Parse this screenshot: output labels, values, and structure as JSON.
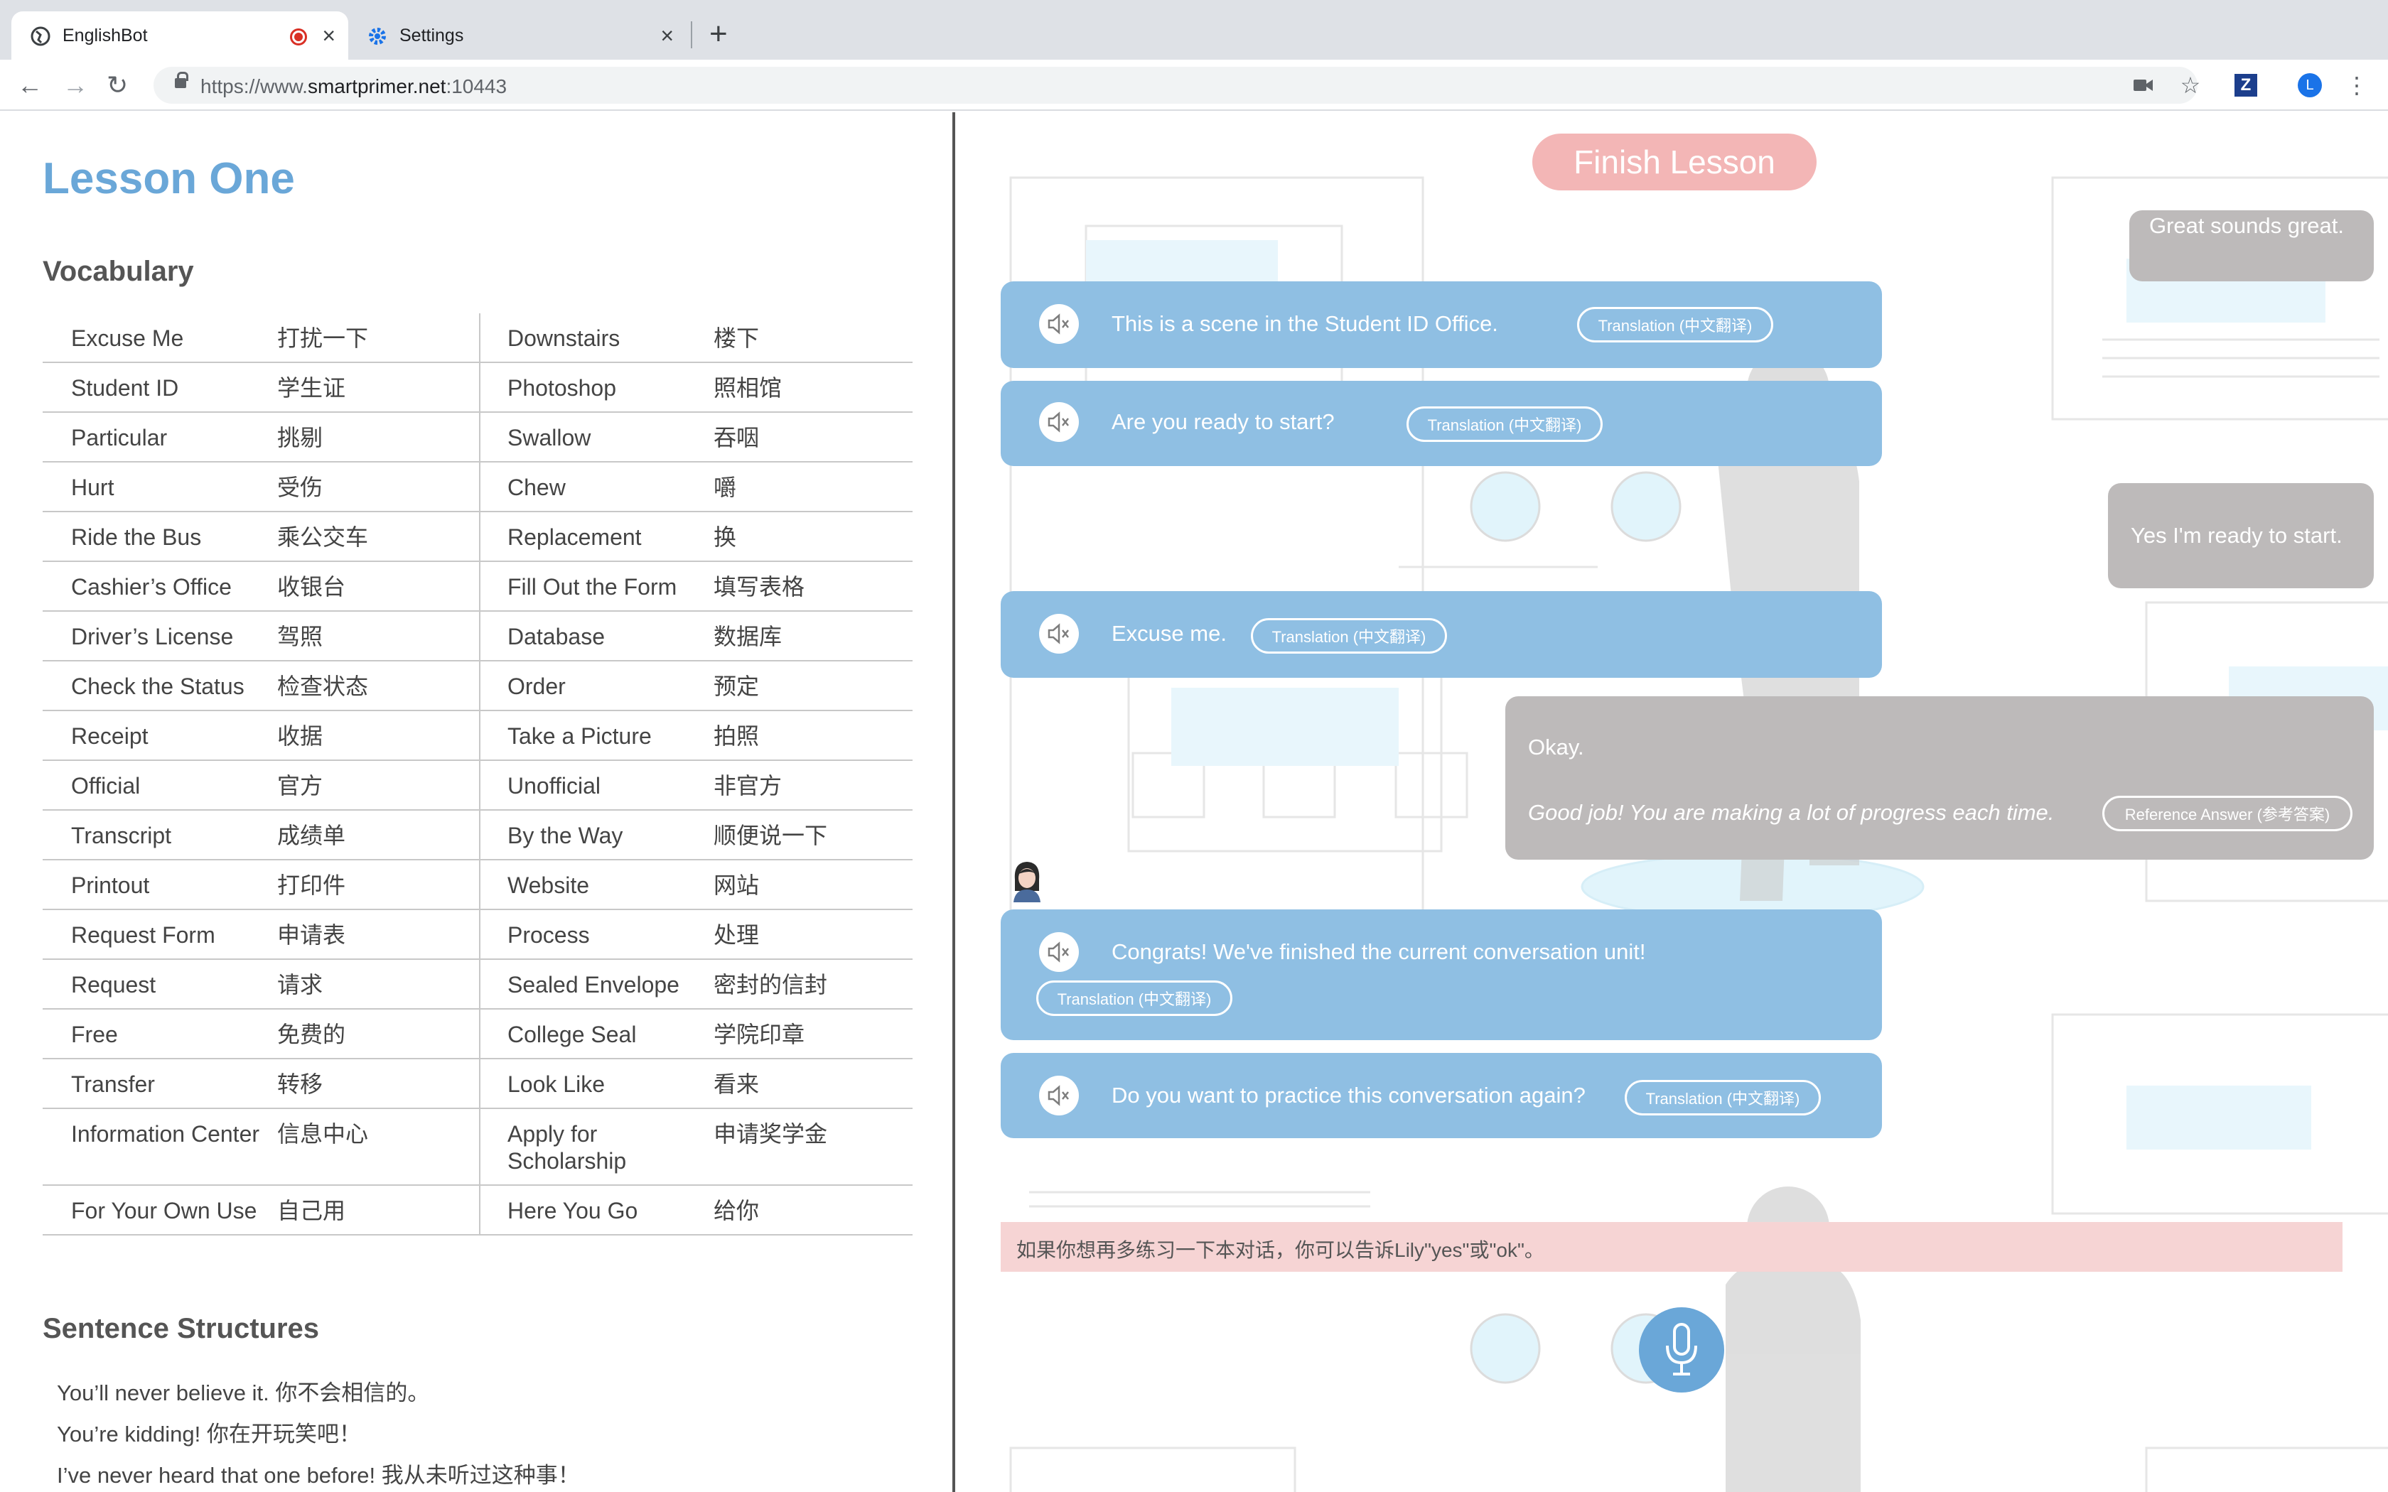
{
  "browser": {
    "tabs": [
      {
        "title": "EnglishBot",
        "active": true
      },
      {
        "title": "Settings",
        "active": false
      }
    ],
    "url": {
      "prefix": "https://www.",
      "host": "smartprimer.net",
      "port": ":10443"
    },
    "profile_letter": "L"
  },
  "lesson": {
    "title": "Lesson One",
    "vocab_heading": "Vocabulary",
    "vocab": [
      [
        "Excuse Me",
        "打扰一下",
        "Downstairs",
        "楼下"
      ],
      [
        "Student ID",
        "学生证",
        "Photoshop",
        "照相馆"
      ],
      [
        "Particular",
        "挑剔",
        "Swallow",
        "吞咽"
      ],
      [
        "Hurt",
        "受伤",
        "Chew",
        "嚼"
      ],
      [
        "Ride the Bus",
        "乘公交车",
        "Replacement",
        "换"
      ],
      [
        "Cashier’s Office",
        "收银台",
        "Fill Out the Form",
        "填写表格"
      ],
      [
        "Driver’s License",
        "驾照",
        "Database",
        "数据库"
      ],
      [
        "Check the Status",
        "检查状态",
        "Order",
        "预定"
      ],
      [
        "Receipt",
        "收据",
        "Take a Picture",
        "拍照"
      ],
      [
        "Official",
        "官方",
        "Unofficial",
        "非官方"
      ],
      [
        "Transcript",
        "成绩单",
        "By the Way",
        "顺便说一下"
      ],
      [
        "Printout",
        "打印件",
        "Website",
        "网站"
      ],
      [
        "Request Form",
        "申请表",
        "Process",
        "处理"
      ],
      [
        "Request",
        "请求",
        "Sealed Envelope",
        "密封的信封"
      ],
      [
        "Free",
        "免费的",
        "College Seal",
        "学院印章"
      ],
      [
        "Transfer",
        "转移",
        "Look Like",
        "看来"
      ],
      [
        "Information Center",
        "信息中心",
        "Apply for Scholarship",
        "申请奖学金"
      ],
      [
        "For Your Own Use",
        "自己用",
        "Here You Go",
        "给你"
      ]
    ],
    "sentence_heading": "Sentence Structures",
    "sentences": [
      "You’ll never believe it. 你不会相信的。",
      "You’re kidding! 你在开玩笑吧！",
      "I’ve never heard that one before! 我从未听过这种事！"
    ]
  },
  "chat": {
    "finish_label": "Finish Lesson",
    "translation_label": "Translation (中文翻译)",
    "reference_label": "Reference Answer (参考答案)",
    "top_reply": "Great sounds great.",
    "bot1": "This is a scene in the Student ID Office.",
    "bot2": "Are you ready to start?",
    "user1": "Yes I'm ready to start.",
    "bot3": "Excuse me.",
    "feedback_reply": "Okay.",
    "feedback_comment": "Good job! You are making a lot of progress each time.",
    "bot4": "Congrats! We've finished the current conversation unit!",
    "bot5": "Do you want to practice this conversation again?",
    "tip": "如果你想再多练习一下本对话，你可以告诉Lily\"yes\"或\"ok\"。"
  },
  "colors": {
    "accent": "#6aa7d8",
    "bot_bubble": "#8fbfe3",
    "user_bubble": "#bdbaba",
    "finish_button": "#f3b6b6",
    "tip_bg": "#f6d4d4"
  }
}
